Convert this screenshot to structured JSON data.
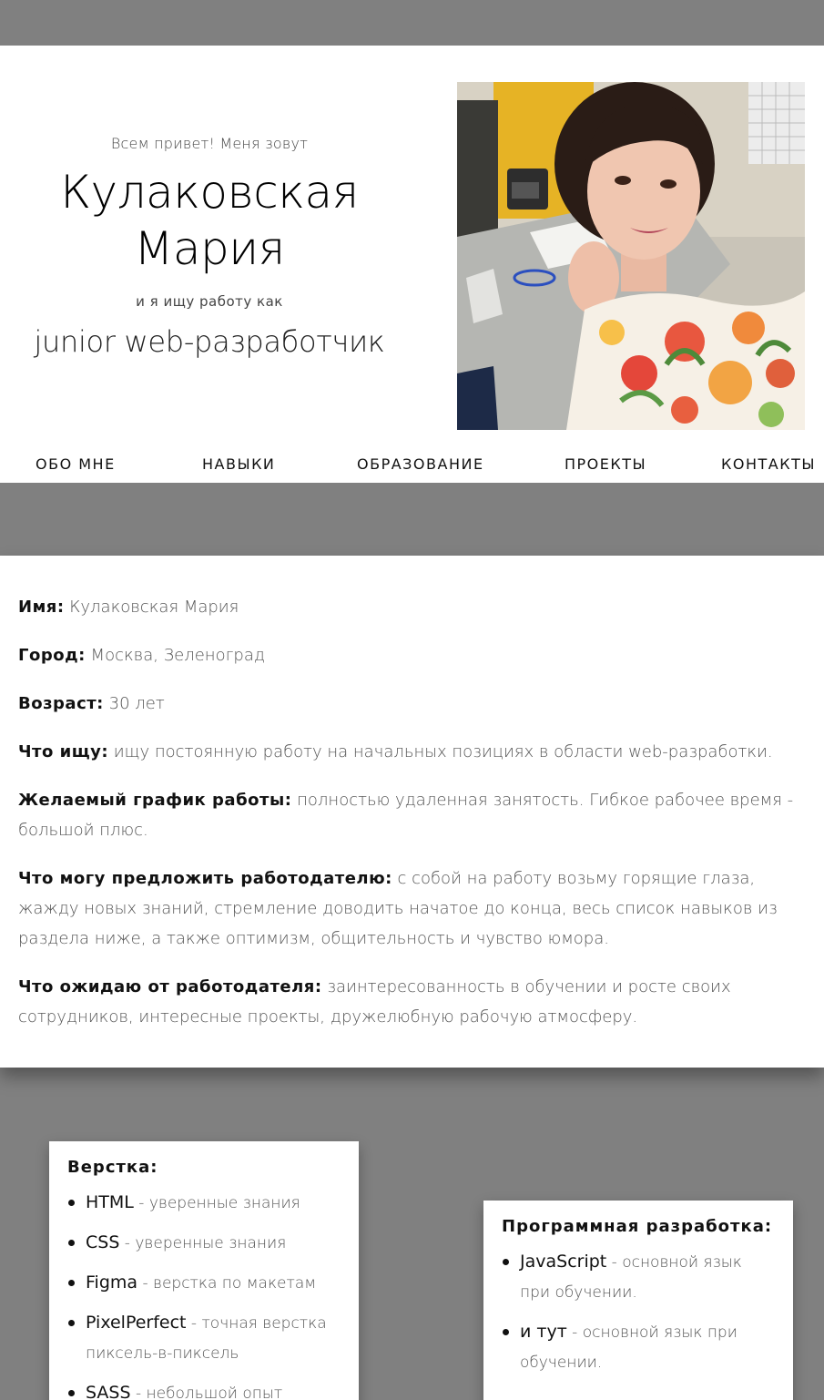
{
  "header": {
    "greeting": "Всем привет! Меня зовут",
    "name": "Кулаковская Мария",
    "seeking": "и я ищу работу как",
    "position": "junior web-разработчик"
  },
  "nav": {
    "about": "ОБО МНЕ",
    "skills": "НАВЫКИ",
    "education": "ОБРАЗОВАНИЕ",
    "projects": "ПРОЕКТЫ",
    "contacts": "КОНТАКТЫ"
  },
  "about": [
    {
      "label": "Имя:",
      "value": " Кулаковская Мария"
    },
    {
      "label": "Город:",
      "value": " Москва, Зеленоград"
    },
    {
      "label": "Возраст:",
      "value": " 30 лет"
    },
    {
      "label": "Что ищу:",
      "value": " ищу постоянную работу на начальных позициях в области web-разработки."
    },
    {
      "label": "Желаемый график работы:",
      "value": " полностью удаленная занятость. Гибкое рабочее время - большой плюс."
    },
    {
      "label": "Что могу предложить работодателю:",
      "value": " с собой на работу возьму горящие глаза, жажду новых знаний, стремление доводить начатое до конца, весь список навыков из раздела ниже, а также оптимизм, общительность и чувство юмора."
    },
    {
      "label": "Что ожидаю от работодателя:",
      "value": " заинтересованность в обучении и росте своих сотрудников, интересные проекты, дружелюбную рабочую атмосферу."
    }
  ],
  "skills": {
    "layout": {
      "title": "Верстка:",
      "items": [
        {
          "name": "HTML",
          "desc": " - уверенные знания"
        },
        {
          "name": "CSS",
          "desc": " - уверенные знания"
        },
        {
          "name": "Figma",
          "desc": " - верстка по макетам"
        },
        {
          "name": "PixelPerfect",
          "desc": " - точная верстка пиксель-в-пиксель"
        },
        {
          "name": "SASS",
          "desc": " - небольшой опыт"
        }
      ]
    },
    "dev": {
      "title": "Программная разработка:",
      "items": [
        {
          "name": "JavaScript",
          "desc": " - основной язык при обучении."
        },
        {
          "name": "и тут",
          "desc": " - основной язык при обучении."
        }
      ]
    }
  },
  "colors": {
    "page_bg": "#808080",
    "card_bg": "#ffffff"
  },
  "photo": {
    "subject": "portrait-photo"
  }
}
